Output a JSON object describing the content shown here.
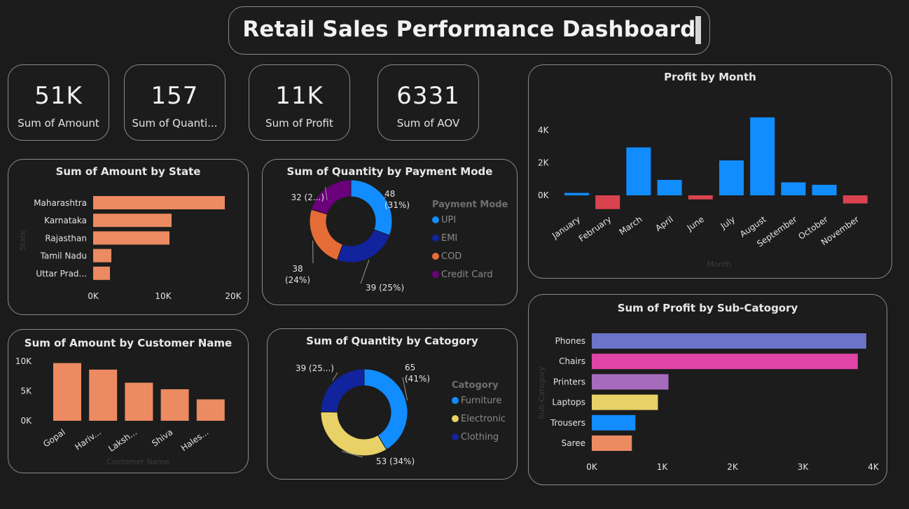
{
  "header": {
    "title": "Retail Sales Performance Dashboard"
  },
  "kpis": [
    {
      "value": "51K",
      "label": "Sum of Amount"
    },
    {
      "value": "157",
      "label": "Sum of Quanti..."
    },
    {
      "value": "11K",
      "label": "Sum of Profit"
    },
    {
      "value": "6331",
      "label": "Sum of AOV"
    }
  ],
  "colors": {
    "orange": "#ec8a61",
    "blue": "#118dff",
    "red": "#d9434f"
  },
  "chart_data": [
    {
      "id": "amount-by-state",
      "type": "bar",
      "orientation": "horizontal",
      "title": "Sum of Amount by State",
      "ylabel": "State",
      "categories": [
        "Maharashtra",
        "Karnataka",
        "Rajasthan",
        "Tamil Nadu",
        "Uttar Prad..."
      ],
      "values": [
        18800,
        11200,
        10900,
        2600,
        2400
      ],
      "xlim": [
        0,
        20000
      ],
      "xticks": [
        "0K",
        "10K",
        "20K"
      ],
      "color": "#ec8a61"
    },
    {
      "id": "quantity-by-payment",
      "type": "pie",
      "donut": true,
      "title": "Sum of Quantity by Payment Mode",
      "legend_title": "Payment Mode",
      "slices": [
        {
          "name": "UPI",
          "value": 48,
          "label": "48\n(31%)",
          "color": "#118dff"
        },
        {
          "name": "EMI",
          "value": 39,
          "label": "39 (25%)",
          "color": "#12239e"
        },
        {
          "name": "COD",
          "value": 38,
          "label": "38\n(24%)",
          "color": "#e66c37"
        },
        {
          "name": "Credit Card",
          "value": 32,
          "label": "32 (2...)",
          "color": "#6b007b"
        }
      ]
    },
    {
      "id": "profit-by-month",
      "type": "bar",
      "title": "Profit by Month",
      "xlabel": "Month",
      "categories": [
        "January",
        "February",
        "March",
        "April",
        "June",
        "July",
        "August",
        "September",
        "October",
        "November"
      ],
      "values": [
        300,
        -1700,
        5900,
        1900,
        -500,
        4300,
        9600,
        1600,
        1300,
        -1000
      ],
      "ylim": [
        -2500,
        10000
      ],
      "yticks": [
        {
          "value": 0,
          "label": "0K"
        },
        {
          "value": 4000,
          "label": "2K"
        },
        {
          "value": 8000,
          "label": "4K"
        }
      ],
      "positive_color": "#118dff",
      "negative_color": "#d9434f"
    },
    {
      "id": "amount-by-customer",
      "type": "bar",
      "title": "Sum of Amount by Customer Name",
      "xlabel": "Customer Name",
      "categories": [
        "Gopal",
        "Hariv...",
        "Laksh...",
        "Shiva",
        "Hales..."
      ],
      "values": [
        9700,
        8600,
        6400,
        5300,
        3600
      ],
      "ylim": [
        0,
        10000
      ],
      "yticks": [
        "0K",
        "5K",
        "10K"
      ],
      "color": "#ec8a61"
    },
    {
      "id": "quantity-by-category",
      "type": "pie",
      "donut": true,
      "title": "Sum of Quantity by Catogory",
      "legend_title": "Catogory",
      "slices": [
        {
          "name": "Furniture",
          "value": 65,
          "label": "65\n(41%)",
          "color": "#118dff"
        },
        {
          "name": "Electronic",
          "value": 53,
          "label": "53 (34%)",
          "color": "#e8d166"
        },
        {
          "name": "Clothing",
          "value": 39,
          "label": "39 (25...)",
          "color": "#12239e"
        }
      ]
    },
    {
      "id": "profit-by-subcategory",
      "type": "bar",
      "orientation": "horizontal",
      "title": "Sum of Profit by Sub-Catogory",
      "ylabel": "Sub-Catogory",
      "categories": [
        "Phones",
        "Chairs",
        "Printers",
        "Laptops",
        "Trousers",
        "Saree"
      ],
      "values": [
        3900,
        3780,
        1090,
        940,
        620,
        570
      ],
      "xlim": [
        0,
        4000
      ],
      "xticks": [
        "0K",
        "1K",
        "2K",
        "3K",
        "4K"
      ],
      "colors": [
        "#6b74c8",
        "#e044a7",
        "#a66bbd",
        "#e8d166",
        "#118dff",
        "#ec8a61"
      ]
    }
  ]
}
